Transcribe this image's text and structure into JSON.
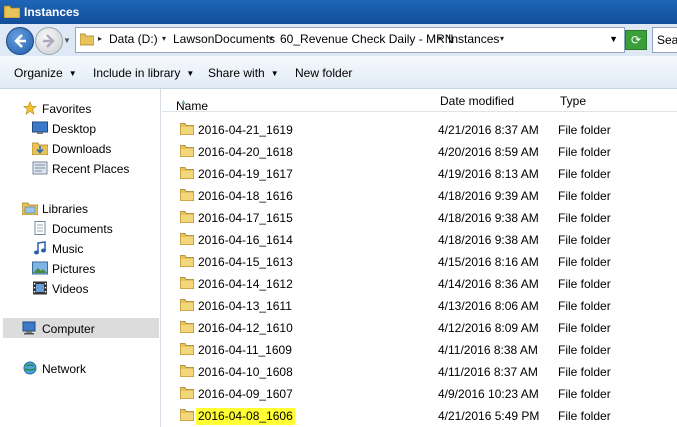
{
  "window": {
    "title": "Instances"
  },
  "address": {
    "crumbs": [
      "Data (D:)",
      "LawsonDocuments",
      "60_Revenue Check Daily - MRN",
      "Instances"
    ],
    "search_text": "Sea"
  },
  "toolbar": {
    "organize": "Organize",
    "include_in_library": "Include in library",
    "share_with": "Share with",
    "new_folder": "New folder"
  },
  "nav": {
    "favorites": "Favorites",
    "desktop": "Desktop",
    "downloads": "Downloads",
    "recent_places": "Recent Places",
    "libraries": "Libraries",
    "documents": "Documents",
    "music": "Music",
    "pictures": "Pictures",
    "videos": "Videos",
    "computer": "Computer",
    "network": "Network"
  },
  "columns": {
    "name": "Name",
    "date_modified": "Date modified",
    "type": "Type"
  },
  "files": [
    {
      "name": "2016-04-21_1619",
      "date": "4/21/2016 8:37 AM",
      "type": "File folder"
    },
    {
      "name": "2016-04-20_1618",
      "date": "4/20/2016 8:59 AM",
      "type": "File folder"
    },
    {
      "name": "2016-04-19_1617",
      "date": "4/19/2016 8:13 AM",
      "type": "File folder"
    },
    {
      "name": "2016-04-18_1616",
      "date": "4/18/2016 9:39 AM",
      "type": "File folder"
    },
    {
      "name": "2016-04-17_1615",
      "date": "4/18/2016 9:38 AM",
      "type": "File folder"
    },
    {
      "name": "2016-04-16_1614",
      "date": "4/18/2016 9:38 AM",
      "type": "File folder"
    },
    {
      "name": "2016-04-15_1613",
      "date": "4/15/2016 8:16 AM",
      "type": "File folder"
    },
    {
      "name": "2016-04-14_1612",
      "date": "4/14/2016 8:36 AM",
      "type": "File folder"
    },
    {
      "name": "2016-04-13_1611",
      "date": "4/13/2016 8:06 AM",
      "type": "File folder"
    },
    {
      "name": "2016-04-12_1610",
      "date": "4/12/2016 8:09 AM",
      "type": "File folder"
    },
    {
      "name": "2016-04-11_1609",
      "date": "4/11/2016 8:38 AM",
      "type": "File folder"
    },
    {
      "name": "2016-04-10_1608",
      "date": "4/11/2016 8:37 AM",
      "type": "File folder"
    },
    {
      "name": "2016-04-09_1607",
      "date": "4/9/2016 10:23 AM",
      "type": "File folder"
    },
    {
      "name": "2016-04-08_1606",
      "date": "4/21/2016 5:49 PM",
      "type": "File folder",
      "highlighted": true
    }
  ],
  "colors": {
    "highlight": "#ffff33",
    "folder": "#e8c25a"
  }
}
